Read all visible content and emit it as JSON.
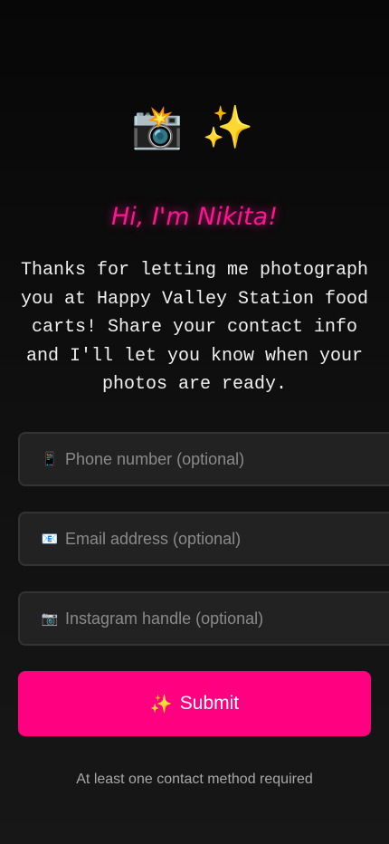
{
  "hero": {
    "camera_icon": "📸",
    "sparkles_icon": "✨"
  },
  "greeting": "Hi, I'm Nikita!",
  "intro": "Thanks for letting me photograph you at Happy Valley Station food carts! Share your contact info and I'll let you know when your photos are ready.",
  "form": {
    "phone": {
      "icon": "📱",
      "placeholder": "Phone number (optional)",
      "value": ""
    },
    "email": {
      "icon": "📧",
      "placeholder": "Email address (optional)",
      "value": ""
    },
    "instagram": {
      "icon": "📷",
      "placeholder": "Instagram handle (optional)",
      "value": ""
    },
    "submit": {
      "icon": "✨",
      "label": "Submit"
    }
  },
  "note": "At least one contact method required",
  "colors": {
    "accent": "#ff0080",
    "greeting": "#ff1493",
    "field_bg": "#222222",
    "background": "#0f0f0f"
  }
}
